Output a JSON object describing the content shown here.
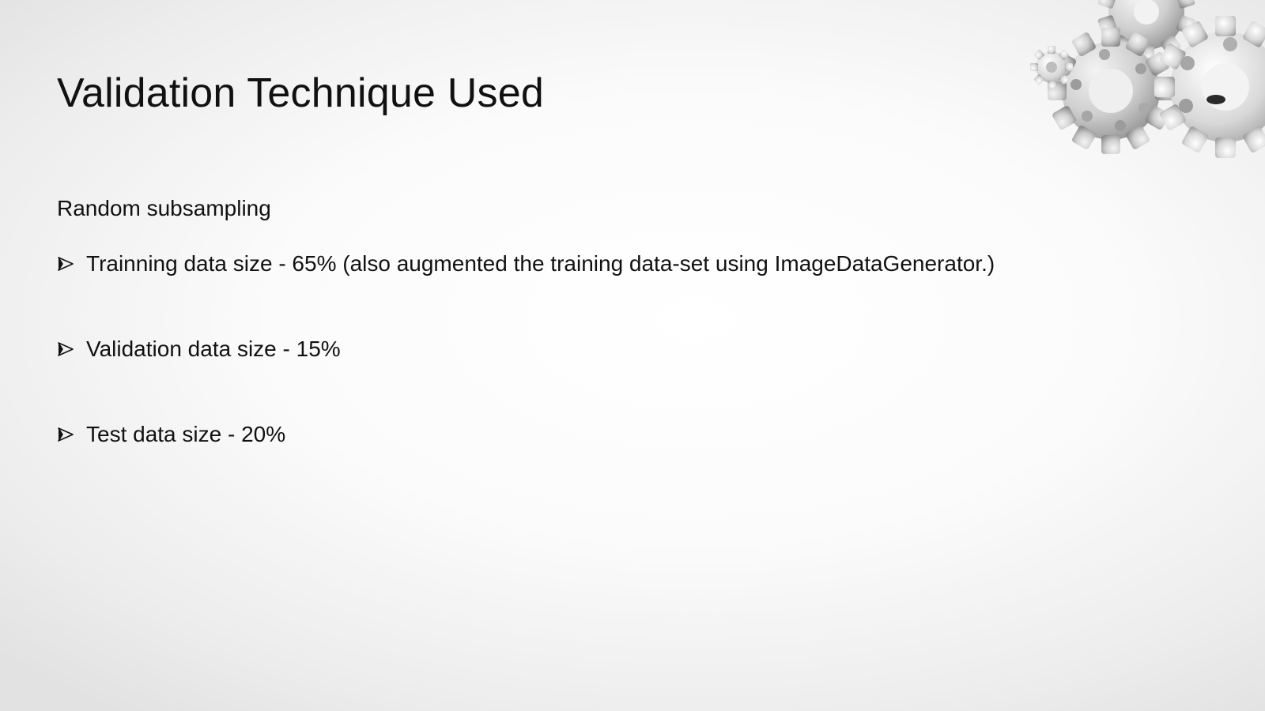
{
  "slide": {
    "title": "Validation Technique Used",
    "subtitle": "Random subsampling",
    "bullets": [
      "Trainning data size - 65% (also augmented the training data-set using ImageDataGenerator.)",
      "Validation data size - 15%",
      "Test data size - 20%"
    ]
  },
  "icons": {
    "bullet": "arrowhead-bullet-icon",
    "decoration": "gears-icon"
  },
  "colors": {
    "text": "#111111",
    "gear": "#c9c9c9"
  }
}
